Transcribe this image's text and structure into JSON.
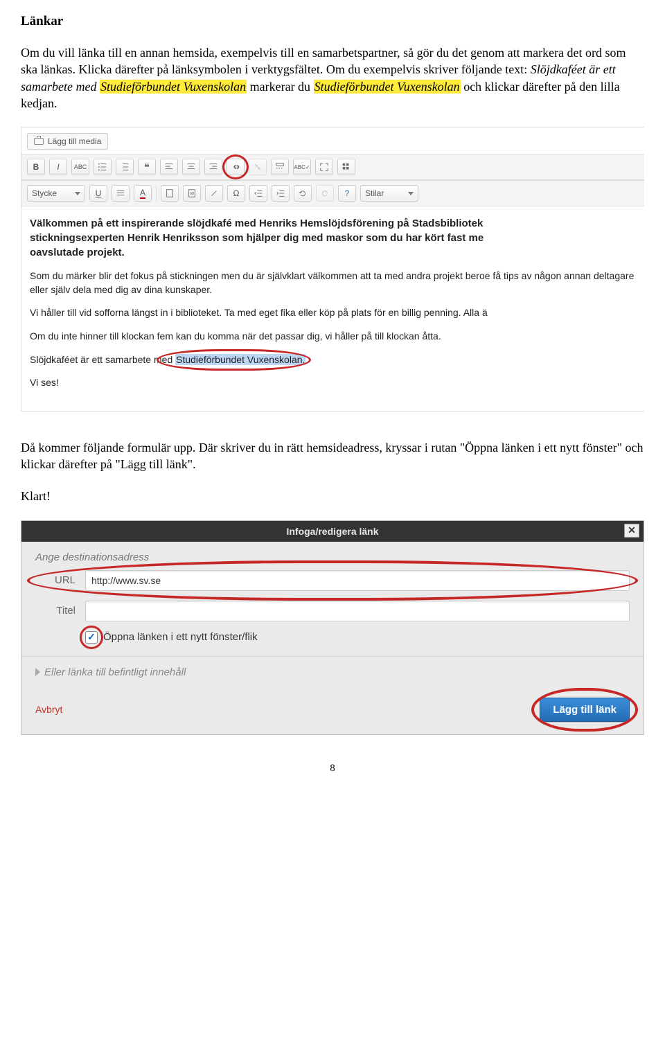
{
  "heading": "Länkar",
  "para1_a": "Om du vill länka till en annan hemsida, exempelvis till en samarbetspartner, så gör du det genom att markera det ord som ska länkas. Klicka därefter på länksymbolen i verktygsfältet. Om du exempelvis skriver följande text: ",
  "para1_b": "Slöjdkaféet är ett samarbete med ",
  "para1_c": "Studieförbundet Vuxenskolan",
  "para1_d": " markerar du ",
  "para1_e": "Studieförbundet Vuxenskolan",
  "para1_f": " och klickar därefter på den lilla kedjan.",
  "editor": {
    "add_media": "Lägg till media",
    "format_select": "Stycke",
    "styles_select": "Stilar",
    "content": {
      "b1a": "Välkommen på ett inspirerande slöjdkafé med Henriks Hemslöjdsförening på Stadsbibliotek",
      "b1b": "stickningsexperten Henrik Henriksson som hjälper dig med maskor som du har kört fast me",
      "b1c": "oavslutade projekt.",
      "p2": "Som du märker blir det fokus på stickningen men du är självklart välkommen att ta med andra projekt beroe få tips av någon annan deltagare eller själv dela med dig av dina kunskaper.",
      "p3": "Vi håller till vid sofforna längst in i biblioteket. Ta med eget fika eller köp på plats för en billig penning. Alla ä",
      "p4": "Om du inte hinner till klockan fem kan du komma när det passar dig, vi håller på till klockan åtta.",
      "p5a": "Slöjdkaféet är ett samarbete m",
      "p5b": "ed ",
      "p5c": "Studieförbundet Vuxenskolan.",
      "p6": "Vi ses!"
    }
  },
  "para2": "Då kommer följande formulär upp. Där skriver du in rätt hemsideadress, kryssar i rutan \"Öppna länken i ett nytt fönster\" och klickar därefter på \"Lägg till länk\".",
  "para3": "Klart!",
  "dialog": {
    "title": "Infoga/redigera länk",
    "section_label": "Ange destinationsadress",
    "url_label": "URL",
    "url_value": "http://www.sv.se",
    "title_label": "Titel",
    "title_value": "",
    "checkbox_label": "Öppna länken i ett nytt fönster/flik",
    "existing_label": "Eller länka till befintligt innehåll",
    "cancel": "Avbryt",
    "submit": "Lägg till länk"
  },
  "pagenum": "8"
}
